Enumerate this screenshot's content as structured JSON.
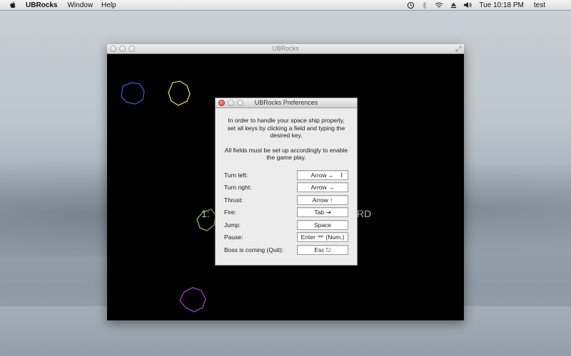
{
  "menubar": {
    "app_name": "UBRocks",
    "items": [
      "Window",
      "Help"
    ],
    "status_icons": [
      "time-machine-icon",
      "bluetooth-icon",
      "wifi-icon",
      "eject-icon",
      "volume-icon"
    ],
    "clock": "Tue 10:18 PM",
    "user": "test"
  },
  "game_window": {
    "title": "UBRocks",
    "score_left": "1:",
    "score_right": "RD"
  },
  "prefs": {
    "title": "UBRocks Preferences",
    "intro_1": "In order to handle your space ship properly, set all keys by clicking a field and typing the desired key.",
    "intro_2": "All fields must be set up accordingly to enable the game play.",
    "rows": [
      {
        "label": "Turn left:",
        "value": "Arrow ←"
      },
      {
        "label": "Turn right:",
        "value": "Arrow →"
      },
      {
        "label": "Thrust:",
        "value": "Arrow ↑"
      },
      {
        "label": "Fire:",
        "value": "Tab ⇥"
      },
      {
        "label": "Jump:",
        "value": "Space"
      },
      {
        "label": "Pause:",
        "value": "Enter ⌤ (Num.)"
      },
      {
        "label": "Boss is coming (Quit):",
        "value": "Esc ⎋"
      }
    ]
  },
  "colors": {
    "game_background": "#000000",
    "asteroid_blue": "#3f53d6",
    "asteroid_yellow": "#d8d35a",
    "asteroid_green": "#8fbf4a",
    "asteroid_purple": "#9b3fc4"
  }
}
